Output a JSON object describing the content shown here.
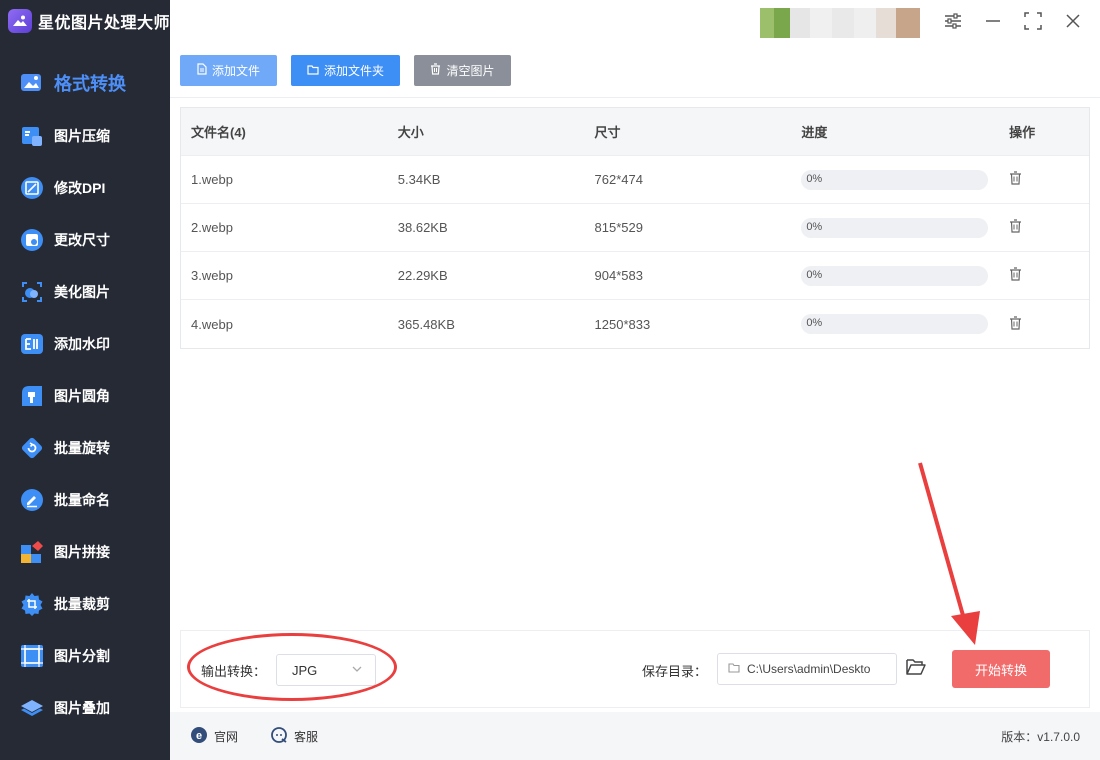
{
  "app": {
    "title": "星优图片处理大师"
  },
  "sidebar": {
    "items": [
      {
        "label": "格式转换",
        "icon": "image-format-icon"
      },
      {
        "label": "图片压缩",
        "icon": "compress-icon"
      },
      {
        "label": "修改DPI",
        "icon": "dpi-icon"
      },
      {
        "label": "更改尺寸",
        "icon": "resize-icon"
      },
      {
        "label": "美化图片",
        "icon": "beautify-icon"
      },
      {
        "label": "添加水印",
        "icon": "watermark-icon"
      },
      {
        "label": "图片圆角",
        "icon": "rounded-corner-icon"
      },
      {
        "label": "批量旋转",
        "icon": "rotate-icon"
      },
      {
        "label": "批量命名",
        "icon": "rename-icon"
      },
      {
        "label": "图片拼接",
        "icon": "puzzle-icon"
      },
      {
        "label": "批量裁剪",
        "icon": "crop-icon"
      },
      {
        "label": "图片分割",
        "icon": "split-icon"
      },
      {
        "label": "图片叠加",
        "icon": "layers-icon"
      }
    ]
  },
  "toolbar": {
    "add_file": "添加文件",
    "add_folder": "添加文件夹",
    "clear_images": "清空图片"
  },
  "table": {
    "headers": {
      "name": "文件名(4)",
      "size": "大小",
      "dimension": "尺寸",
      "progress": "进度",
      "action": "操作"
    },
    "rows": [
      {
        "name": "1.webp",
        "size": "5.34KB",
        "dimension": "762*474",
        "progress": "0%",
        "progress_value": 0
      },
      {
        "name": "2.webp",
        "size": "38.62KB",
        "dimension": "815*529",
        "progress": "0%",
        "progress_value": 0
      },
      {
        "name": "3.webp",
        "size": "22.29KB",
        "dimension": "904*583",
        "progress": "0%",
        "progress_value": 0
      },
      {
        "name": "4.webp",
        "size": "365.48KB",
        "dimension": "1250*833",
        "progress": "0%",
        "progress_value": 0
      }
    ]
  },
  "bottom": {
    "output_label": "输出转换：",
    "output_format": "JPG",
    "save_label": "保存目录：",
    "save_path": "C:\\Users\\admin\\Deskto",
    "start_button": "开始转换"
  },
  "footer": {
    "website": "官网",
    "service": "客服",
    "version": "版本：v1.7.0.0"
  },
  "colors": {
    "sidebar_bg": "#262a35",
    "accent": "#4d8ff7",
    "start_button": "#f26b6b",
    "annotation": "#ea3f3f"
  }
}
